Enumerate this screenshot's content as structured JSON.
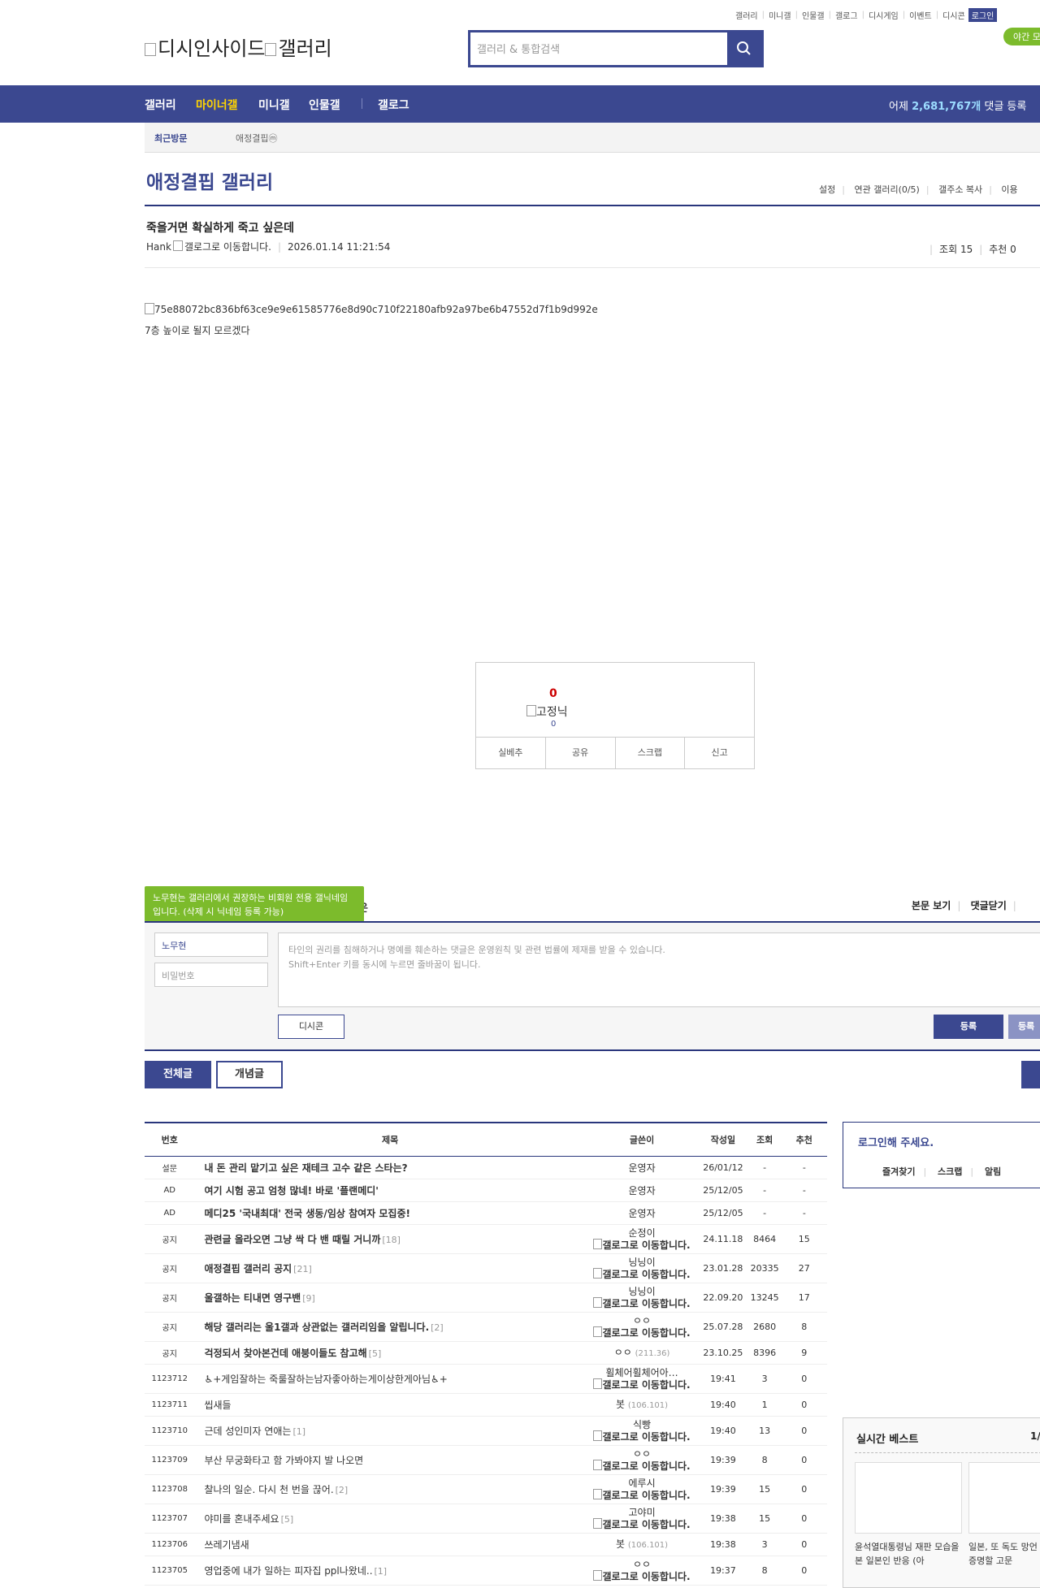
{
  "util_links": [
    "갤러리",
    "미니갤",
    "인물갤",
    "갤로그",
    "디시게임",
    "이벤트",
    "디시콘"
  ],
  "login_label": "로그인",
  "night_mode": "야간 모드",
  "logo_alt": "디시인사이드",
  "logo_gallery_alt": "갤러리",
  "search_placeholder": "갤러리 & 통합검색",
  "nav": {
    "items": [
      "갤러리",
      "마이너갤",
      "미니갤",
      "인물갤",
      "갤로그"
    ],
    "stat_prefix": "어제",
    "stat_value": "2,681,767개",
    "stat_suffix": "댓글 등록"
  },
  "recent": {
    "label": "최근방문",
    "item": "애정결핍ⓜ"
  },
  "gallery": {
    "title": "애정결핍 갤러리",
    "menu": [
      "설정",
      "연관 갤러리(0/5)",
      "갤주소 복사",
      "이용"
    ]
  },
  "post": {
    "title": "죽을거면 확실하게 죽고 싶은데",
    "author": "Hank",
    "gallog_alt": "갤로그로 이동합니다.",
    "date": "2026.01.14 11:21:54",
    "views_label": "조회 15",
    "recommend_label": "추천 0",
    "image_alt": "75e88072bc836bf63ce9e9e61585776e8d90c710f22180afb92a97be6b47552d7f1b9d992e",
    "body": "7층 높이로 될지 모르겠다"
  },
  "vote": {
    "count": "0",
    "fixnick_alt": "고정닉",
    "fixnick_count": "0",
    "actions": [
      "실베추",
      "공유",
      "스크랩",
      "신고"
    ]
  },
  "comment": {
    "tooltip": "노무현는 갤러리에서 권장하는 비회원 전용 갤닉네임입니다. (삭제 시 닉네임 등록 가능)",
    "tooltip_tail": "은",
    "menu": [
      "본문 보기",
      "댓글닫기"
    ],
    "nick_value": "노무현",
    "password_placeholder": "비밀번호",
    "textarea_placeholder_1": "타인의 권리를 침해하거나 명예를 훼손하는 댓글은 운영원칙 및 관련 법률에 제재를 받을 수 있습니다.",
    "textarea_placeholder_2": "Shift+Enter 키를 동시에 누르면 줄바꿈이 됩니다.",
    "dccon_label": "디시콘",
    "submit_label": "등록",
    "submit2_label": "등록"
  },
  "tabs": {
    "all": "전체글",
    "concept": "개념글"
  },
  "list": {
    "headers": [
      "번호",
      "제목",
      "글쓴이",
      "작성일",
      "조회",
      "추천"
    ],
    "gallog_alt": "갤로그로 이동합니다.",
    "rows": [
      {
        "num": "설문",
        "subject": "내 돈 관리 맡기고 싶은 재테크 고수 같은 스타는?",
        "count": "",
        "writer": "운영자",
        "ip": "",
        "gallog": false,
        "date": "26/01/12",
        "views": "-",
        "rec": "-",
        "notice": true
      },
      {
        "num": "AD",
        "subject": "여기 시험 공고 엄청 많네! 바로 '플랜메디'",
        "count": "",
        "writer": "운영자",
        "ip": "",
        "gallog": false,
        "date": "25/12/05",
        "views": "-",
        "rec": "-",
        "notice": true
      },
      {
        "num": "AD",
        "subject": "메디25 '국내최대' 전국 생동/임상 참여자 모집중!",
        "count": "",
        "writer": "운영자",
        "ip": "",
        "gallog": false,
        "date": "25/12/05",
        "views": "-",
        "rec": "-",
        "notice": true
      },
      {
        "num": "공지",
        "subject": "관련글 올라오면 그냥 싹 다 밴 때릴 거니까",
        "count": "[18]",
        "writer": "순정이",
        "ip": "",
        "gallog": true,
        "date": "24.11.18",
        "views": "8464",
        "rec": "15",
        "notice": true
      },
      {
        "num": "공지",
        "subject": "애정결핍 갤러리 공지",
        "count": "[21]",
        "writer": "닝닝이",
        "ip": "",
        "gallog": true,
        "date": "23.01.28",
        "views": "20335",
        "rec": "27",
        "notice": true
      },
      {
        "num": "공지",
        "subject": "울갤하는 티내면 영구밴",
        "count": "[9]",
        "writer": "닝닝이",
        "ip": "",
        "gallog": true,
        "date": "22.09.20",
        "views": "13245",
        "rec": "17",
        "notice": true
      },
      {
        "num": "공지",
        "subject": "해당 갤러리는 울1갤과 상관없는 갤러리임을 알립니다.",
        "count": "[2]",
        "writer": "ㅇㅇ",
        "ip": "",
        "gallog": true,
        "date": "25.07.28",
        "views": "2680",
        "rec": "8",
        "notice": true
      },
      {
        "num": "공지",
        "subject": "걱정되서 찾아본건데 애붕이들도 참고해",
        "count": "[5]",
        "writer": "ㅇㅇ",
        "ip": "(211.36)",
        "gallog": false,
        "date": "23.10.25",
        "views": "8396",
        "rec": "9",
        "notice": true
      },
      {
        "num": "1123712",
        "subject": "♿+게임잘하는 죽룰잘하는남자좋아하는게이상한게아님♿+",
        "count": "",
        "writer": "휠체어휠체어아…",
        "ip": "",
        "gallog": true,
        "date": "19:41",
        "views": "3",
        "rec": "0",
        "notice": false
      },
      {
        "num": "1123711",
        "subject": "씹새들",
        "count": "",
        "writer": "봇",
        "ip": "(106.101)",
        "gallog": false,
        "date": "19:40",
        "views": "1",
        "rec": "0",
        "notice": false
      },
      {
        "num": "1123710",
        "subject": "근데 성인미자 연애는",
        "count": "[1]",
        "writer": "식빵",
        "ip": "",
        "gallog": true,
        "date": "19:40",
        "views": "13",
        "rec": "0",
        "notice": false
      },
      {
        "num": "1123709",
        "subject": "부산 무궁화타고 함 가봐야지 발 나오면",
        "count": "",
        "writer": "ㅇㅇ",
        "ip": "",
        "gallog": true,
        "date": "19:39",
        "views": "8",
        "rec": "0",
        "notice": false
      },
      {
        "num": "1123708",
        "subject": "찰나의 일순. 다시 천 번을 끊어.",
        "count": "[2]",
        "writer": "에루시",
        "ip": "",
        "gallog": true,
        "date": "19:39",
        "views": "15",
        "rec": "0",
        "notice": false
      },
      {
        "num": "1123707",
        "subject": "야미를 혼내주세요",
        "count": "[5]",
        "writer": "고야미",
        "ip": "",
        "gallog": true,
        "date": "19:38",
        "views": "15",
        "rec": "0",
        "notice": false
      },
      {
        "num": "1123706",
        "subject": "쓰레기냄새",
        "count": "",
        "writer": "봇",
        "ip": "(106.101)",
        "gallog": false,
        "date": "19:38",
        "views": "3",
        "rec": "0",
        "notice": false
      },
      {
        "num": "1123705",
        "subject": "영업중에 내가 일하는 피자집 ppl나왔네..",
        "count": "[1]",
        "writer": "ㅇㅇ",
        "ip": "",
        "gallog": true,
        "date": "19:37",
        "views": "8",
        "rec": "0",
        "notice": false
      }
    ]
  },
  "sidebar": {
    "login_title": "로그인해 주세요.",
    "login_menu": [
      "즐겨찾기",
      "스크랩",
      "알림"
    ],
    "best_title": "실시간 베스트",
    "best_page": "1/",
    "best_items": [
      "윤석열대통령님 재판 모습을 본 일본인 반응 (아",
      "일본, 또 독도 망언 일본 땅 증명할 고문"
    ]
  },
  "colors": {
    "brand": "#3b4890",
    "highlight": "#ffd400",
    "green": "#7cbb2c"
  }
}
